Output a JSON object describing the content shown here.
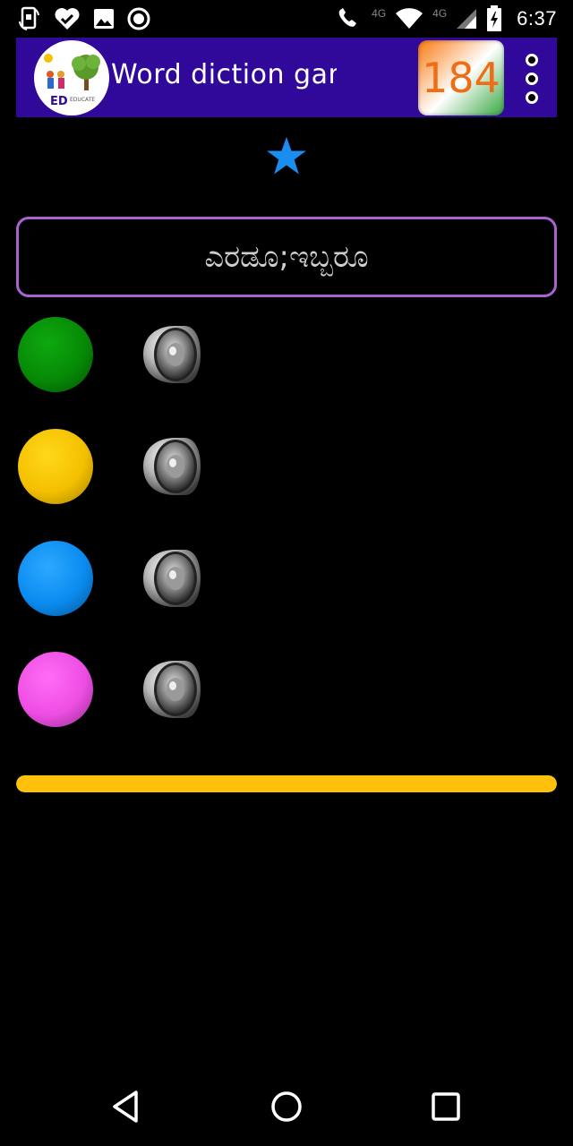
{
  "status_bar": {
    "time": "6:37",
    "network_label": "4G",
    "call_badge": "4G",
    "left_icons": [
      "screen-rotate-icon",
      "heart-check-icon",
      "image-icon",
      "record-icon"
    ],
    "right_icons": [
      "wifi-call-icon",
      "wifi-icon",
      "signal-icon",
      "battery-charging-icon"
    ]
  },
  "app_bar": {
    "title": "Word diction game",
    "score": "184",
    "logo_text": "EDUCATE",
    "colors": {
      "background": "#30099a",
      "score_text": "#f06d18"
    }
  },
  "stars": [
    "star-icon"
  ],
  "word": "ಎರಡೂ;ಇಬ್ಬರೂ",
  "options": [
    {
      "color_name": "green",
      "color": "#068a06",
      "speaker_icon": "speaker-icon"
    },
    {
      "color_name": "yellow",
      "color": "#f4c000",
      "speaker_icon": "speaker-icon"
    },
    {
      "color_name": "blue",
      "color": "#0a8cf0",
      "speaker_icon": "speaker-icon"
    },
    {
      "color_name": "pink",
      "color": "#ee4ee3",
      "speaker_icon": "speaker-icon"
    }
  ],
  "progress": {
    "fraction": 1.0,
    "color": "#ffc10a"
  },
  "nav_bar": {
    "icons": [
      "back-icon",
      "home-icon",
      "recents-icon"
    ]
  }
}
